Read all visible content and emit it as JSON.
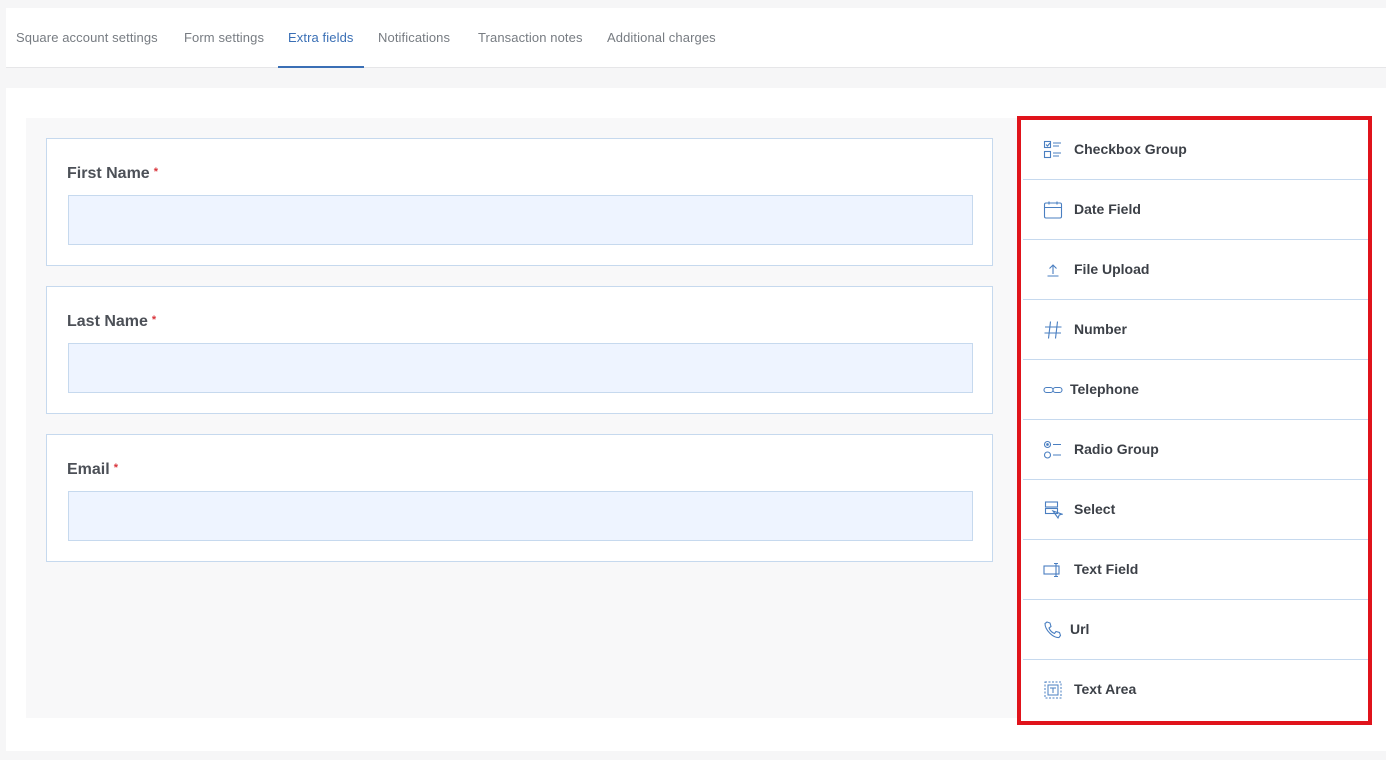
{
  "tabs": [
    {
      "label": "Square account settings",
      "active": false
    },
    {
      "label": "Form settings",
      "active": false
    },
    {
      "label": "Extra fields",
      "active": true
    },
    {
      "label": "Notifications",
      "active": false
    },
    {
      "label": "Transaction notes",
      "active": false
    },
    {
      "label": "Additional charges",
      "active": false
    }
  ],
  "form": {
    "fields": [
      {
        "label": "First Name",
        "required_mark": "*",
        "value": ""
      },
      {
        "label": "Last Name",
        "required_mark": "*",
        "value": ""
      },
      {
        "label": "Email",
        "required_mark": "*",
        "value": ""
      }
    ]
  },
  "palette": {
    "highlight_color": "#e0131b",
    "items": [
      {
        "label": "Checkbox Group",
        "icon": "checkbox-group-icon"
      },
      {
        "label": "Date Field",
        "icon": "calendar-icon"
      },
      {
        "label": "File Upload",
        "icon": "upload-icon"
      },
      {
        "label": "Number",
        "icon": "hash-icon"
      },
      {
        "label": "Telephone",
        "icon": "link-icon"
      },
      {
        "label": "Radio Group",
        "icon": "radio-group-icon"
      },
      {
        "label": "Select",
        "icon": "select-icon"
      },
      {
        "label": "Text Field",
        "icon": "text-field-icon"
      },
      {
        "label": "Url",
        "icon": "phone-icon"
      },
      {
        "label": "Text Area",
        "icon": "text-area-icon"
      }
    ]
  },
  "colors": {
    "accent": "#3a6fb5",
    "field_border": "#c6d9ee",
    "input_bg": "#eef4ff",
    "required": "#d9343b"
  }
}
